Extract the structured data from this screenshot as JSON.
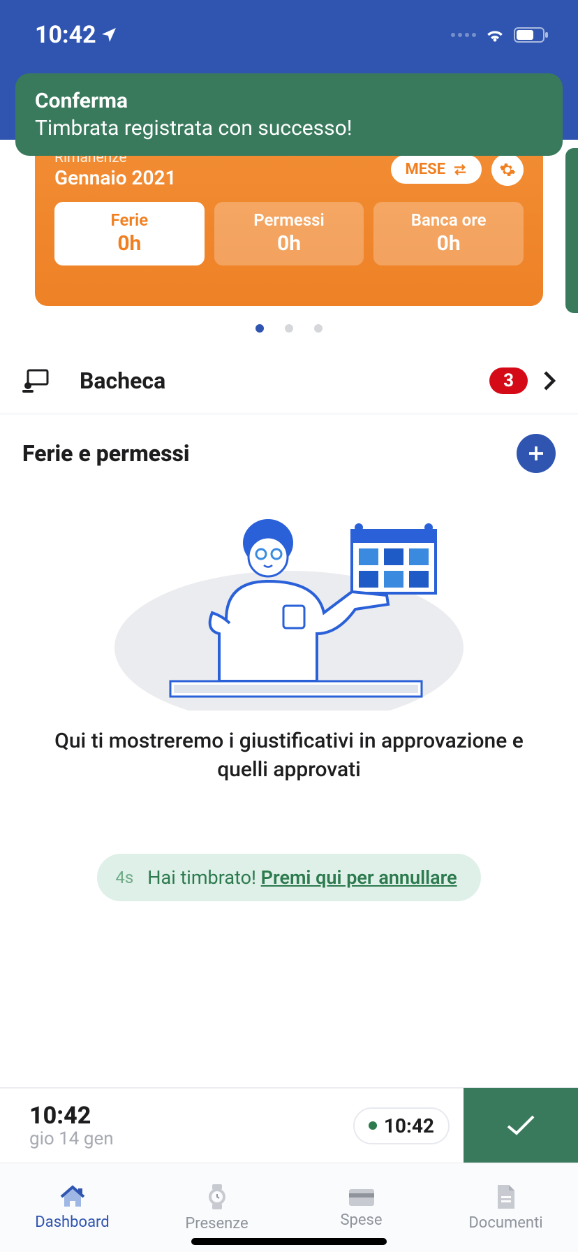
{
  "status": {
    "time": "10:42"
  },
  "toast": {
    "title": "Conferma",
    "subtitle": "Timbrata registrata con successo!"
  },
  "card": {
    "label": "Rimanenze",
    "month": "Gennaio 2021",
    "toggle": "MESE",
    "tabs": [
      {
        "label": "Ferie",
        "value": "0h"
      },
      {
        "label": "Permessi",
        "value": "0h"
      },
      {
        "label": "Banca ore",
        "value": "0h"
      }
    ]
  },
  "bacheca": {
    "title": "Bacheca",
    "badge": "3"
  },
  "ferie": {
    "title": "Ferie e permessi",
    "caption": "Qui ti mostreremo i giustificativi in approvazione e quelli approvati"
  },
  "undo": {
    "ago": "4s",
    "text": "Hai timbrato! ",
    "link": "Premi qui per annullare"
  },
  "timebar": {
    "time": "10:42",
    "date": "gio 14 gen",
    "chip": "10:42"
  },
  "tabs": {
    "dashboard": "Dashboard",
    "presenze": "Presenze",
    "spese": "Spese",
    "documenti": "Documenti"
  }
}
